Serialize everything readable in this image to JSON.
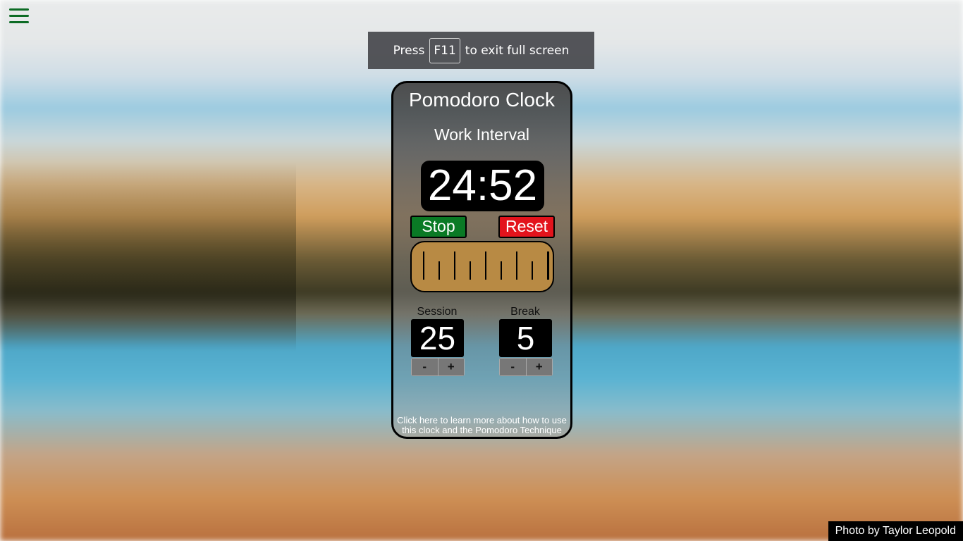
{
  "fullscreen_banner": {
    "prefix": "Press",
    "key": "F11",
    "suffix": "to exit full screen"
  },
  "clock": {
    "title": "Pomodoro Clock",
    "mode": "Work Interval",
    "time": "24:52",
    "stop_label": "Stop",
    "reset_label": "Reset",
    "progress_fraction": 0.0053,
    "session": {
      "label": "Session",
      "value": "25",
      "minus": "-",
      "plus": "+"
    },
    "break": {
      "label": "Break",
      "value": "5",
      "minus": "-",
      "plus": "+"
    },
    "learn_more": "Click here to learn more about how to use this clock and the Pomodoro Technique"
  },
  "photo_credit": "Photo by Taylor Leopold",
  "colors": {
    "menu": "#0c6b24",
    "stop": "#0a7a25",
    "reset": "#e3131c",
    "progress_fill": "#b88a44"
  },
  "icons": {
    "menu": "hamburger-menu-icon"
  }
}
